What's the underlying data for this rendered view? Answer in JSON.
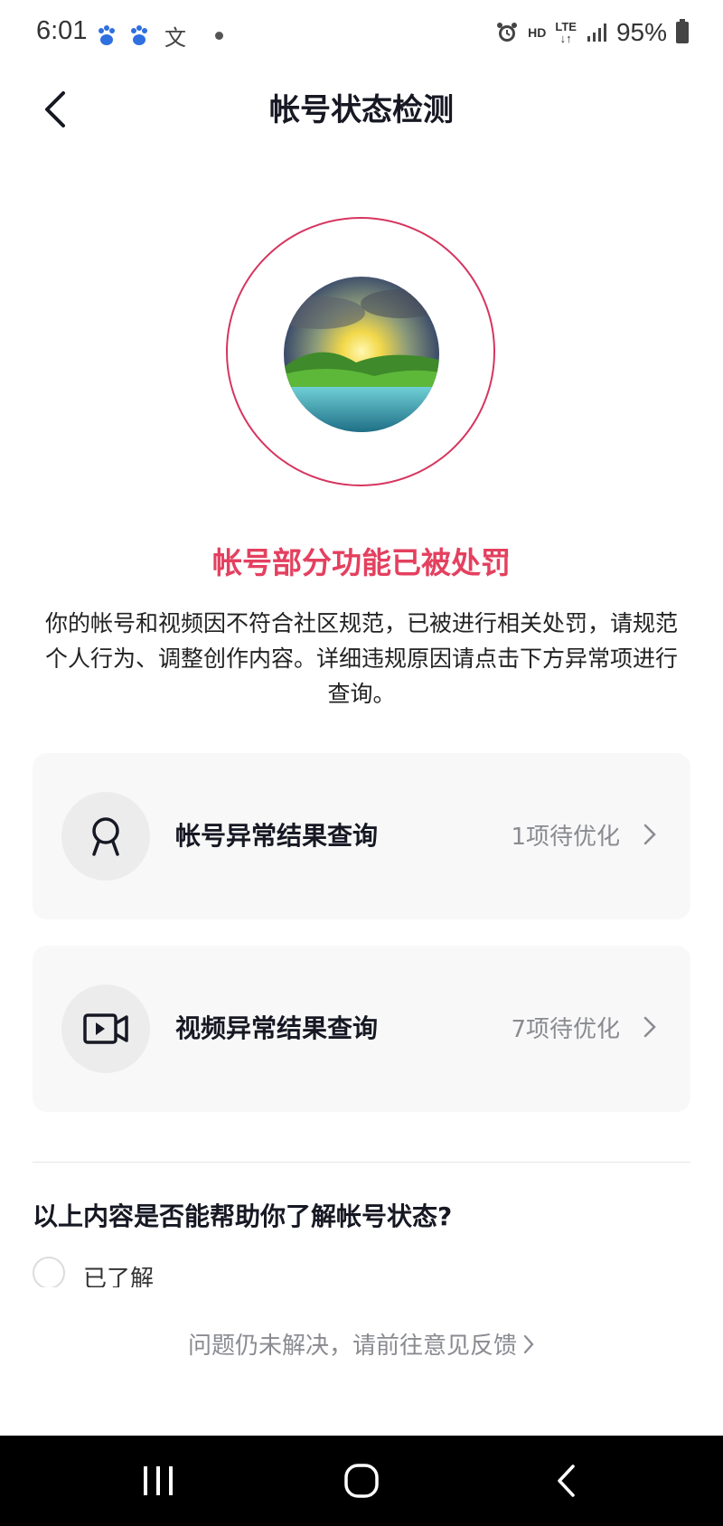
{
  "status_bar": {
    "time": "6:01",
    "wen_glyph": "文",
    "hd": "HD",
    "lte": "LTE",
    "battery": "95%"
  },
  "header": {
    "title": "帐号状态检测"
  },
  "status": {
    "title": "帐号部分功能已被处罚",
    "description": "你的帐号和视频因不符合社区规范，已被进行相关处罚，请规范个人行为、调整创作内容。详细违规原因请点击下方异常项进行查询。"
  },
  "cards": [
    {
      "label": "帐号异常结果查询",
      "count": "1项待优化",
      "icon": "user-icon"
    },
    {
      "label": "视频异常结果查询",
      "count": "7项待优化",
      "icon": "video-icon"
    }
  ],
  "survey": {
    "question": "以上内容是否能帮助你了解帐号状态?",
    "option": "已了解"
  },
  "feedback": {
    "label": "问题仍未解决，请前往意见反馈"
  },
  "colors": {
    "accent": "#e4405f",
    "ring": "#d6355f",
    "card_bg": "#f8f8f8",
    "muted_text": "#8a8b91"
  }
}
